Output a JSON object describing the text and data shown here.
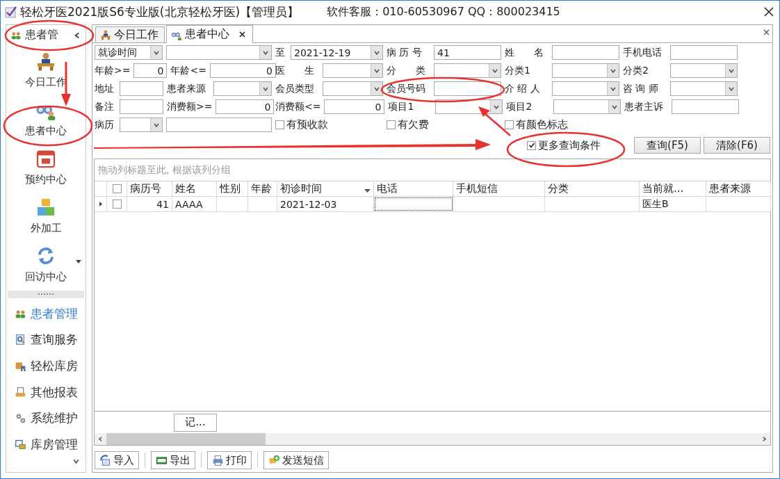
{
  "window": {
    "title": "轻松牙医2021版S6专业版(北京轻松牙医)【管理员】",
    "support": "软件客服：010-60530967 QQ：800023415"
  },
  "sidebar": {
    "header": "患者管",
    "launchers": [
      {
        "label": "今日工作"
      },
      {
        "label": "患者中心"
      },
      {
        "label": "预约中心"
      },
      {
        "label": "外加工"
      },
      {
        "label": "回访中心"
      }
    ],
    "nav": [
      {
        "label": "患者管理",
        "selected": true
      },
      {
        "label": "查询服务",
        "selected": false
      },
      {
        "label": "轻松库房",
        "selected": false
      },
      {
        "label": "其他报表",
        "selected": false
      },
      {
        "label": "系统维护",
        "selected": false
      },
      {
        "label": "库房管理",
        "selected": false
      }
    ]
  },
  "tabs": [
    {
      "label": "今日工作",
      "selected": false,
      "closable": false
    },
    {
      "label": "患者中心",
      "selected": true,
      "closable": true
    }
  ],
  "filters": {
    "rows": [
      {
        "left": [
          {
            "kind": "select",
            "value": "就诊时间"
          },
          {
            "kind": "select"
          }
        ],
        "right": [
          {
            "kind": "label",
            "text": "至"
          },
          {
            "kind": "select",
            "value": "2021-12-19"
          },
          {
            "kind": "label",
            "text": "病 历 号"
          },
          {
            "kind": "input",
            "value": "41"
          },
          {
            "kind": "label",
            "text": "姓　　名"
          },
          {
            "kind": "input"
          },
          {
            "kind": "label",
            "text": "手机电话"
          },
          {
            "kind": "input"
          }
        ]
      },
      {
        "left": [
          {
            "kind": "label",
            "text": "年龄>="
          },
          {
            "kind": "number",
            "value": "0"
          },
          {
            "kind": "label",
            "text": "年龄<="
          },
          {
            "kind": "number",
            "value": "0"
          }
        ],
        "right": [
          {
            "kind": "label",
            "text": "医　　生"
          },
          {
            "kind": "select"
          },
          {
            "kind": "label",
            "text": "分　　类"
          },
          {
            "kind": "select"
          },
          {
            "kind": "label",
            "text": "分类1"
          },
          {
            "kind": "select"
          },
          {
            "kind": "label",
            "text": "分类2"
          },
          {
            "kind": "select"
          }
        ]
      },
      {
        "left": [
          {
            "kind": "label",
            "text": "地址"
          },
          {
            "kind": "input"
          },
          {
            "kind": "label",
            "text": "患者来源"
          },
          {
            "kind": "select"
          }
        ],
        "right": [
          {
            "kind": "label",
            "text": "会员类型"
          },
          {
            "kind": "select"
          },
          {
            "kind": "label",
            "text": "会员号码"
          },
          {
            "kind": "input"
          },
          {
            "kind": "label",
            "text": "介 绍 人"
          },
          {
            "kind": "select"
          },
          {
            "kind": "label",
            "text": "咨 询 师"
          },
          {
            "kind": "select"
          }
        ]
      },
      {
        "left": [
          {
            "kind": "label",
            "text": "备注"
          },
          {
            "kind": "input"
          },
          {
            "kind": "label",
            "text": "消费额>="
          },
          {
            "kind": "number",
            "value": "0"
          }
        ],
        "right": [
          {
            "kind": "label",
            "text": "消费额<="
          },
          {
            "kind": "number",
            "value": "0"
          },
          {
            "kind": "label",
            "text": "项目1"
          },
          {
            "kind": "select"
          },
          {
            "kind": "label",
            "text": "项目2"
          },
          {
            "kind": "select"
          },
          {
            "kind": "label",
            "text": "患者主诉"
          },
          {
            "kind": "input"
          }
        ]
      },
      {
        "left": [
          {
            "kind": "label",
            "text": "病历"
          },
          {
            "kind": "select"
          },
          {
            "kind": "input"
          }
        ],
        "right": [
          {
            "kind": "checkbox",
            "label": "有预收款",
            "checked": false
          },
          {
            "kind": "checkbox",
            "label": "有欠费",
            "checked": false
          },
          {
            "kind": "checkbox",
            "label": "有颜色标志",
            "checked": false
          }
        ]
      }
    ],
    "more": {
      "label": "更多查询条件",
      "checked": true
    },
    "buttons": [
      "查询(F5)",
      "清除(F6)"
    ]
  },
  "group_panel": {
    "placeholder": "拖动列标题至此, 根据该列分组"
  },
  "table": {
    "select_all": false,
    "columns": [
      {
        "label": "病历号",
        "sorted": false
      },
      {
        "label": "姓名",
        "sorted": false
      },
      {
        "label": "性别",
        "sorted": false
      },
      {
        "label": "年龄",
        "sorted": false
      },
      {
        "label": "初诊时间",
        "sorted": true
      },
      {
        "label": "电话",
        "sorted": false
      },
      {
        "label": "手机短信",
        "sorted": false
      },
      {
        "label": "分类",
        "sorted": false
      },
      {
        "label": "当前就...",
        "sorted": false
      },
      {
        "label": "患者来源",
        "sorted": false
      }
    ],
    "rows": [
      {
        "current": true,
        "checked": false,
        "cells": [
          {
            "text": "41",
            "focused": false
          },
          {
            "text": "AAAA",
            "focused": false
          },
          {
            "focused": false
          },
          {
            "focused": false
          },
          {
            "text": "2021-12-03",
            "focused": false
          },
          {
            "focused": true
          },
          {
            "focused": false
          },
          {
            "focused": false
          },
          {
            "text": "医生B",
            "focused": false
          },
          {
            "focused": false
          }
        ]
      }
    ]
  },
  "footer_button": "记...",
  "toolbar": [
    {
      "label": "导入"
    },
    {
      "label": "导出"
    },
    {
      "label": "打印"
    },
    {
      "label": "发送短信"
    }
  ]
}
